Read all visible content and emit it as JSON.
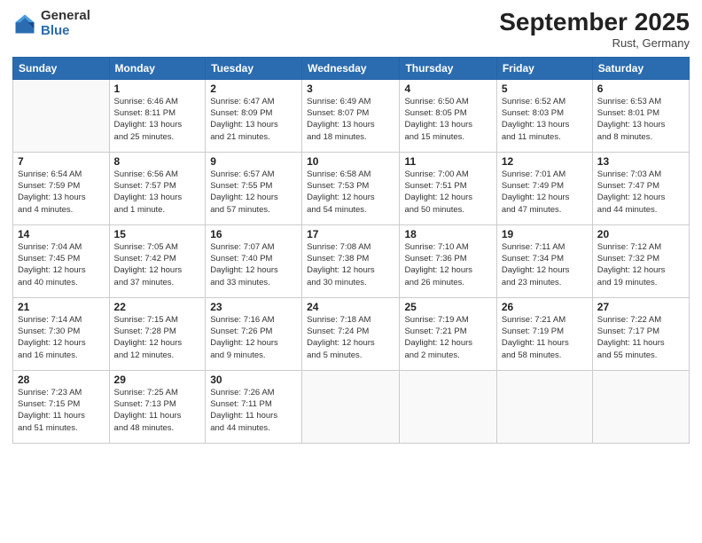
{
  "logo": {
    "general": "General",
    "blue": "Blue"
  },
  "title": "September 2025",
  "location": "Rust, Germany",
  "days_header": [
    "Sunday",
    "Monday",
    "Tuesday",
    "Wednesday",
    "Thursday",
    "Friday",
    "Saturday"
  ],
  "weeks": [
    [
      {
        "num": "",
        "info": ""
      },
      {
        "num": "1",
        "info": "Sunrise: 6:46 AM\nSunset: 8:11 PM\nDaylight: 13 hours\nand 25 minutes."
      },
      {
        "num": "2",
        "info": "Sunrise: 6:47 AM\nSunset: 8:09 PM\nDaylight: 13 hours\nand 21 minutes."
      },
      {
        "num": "3",
        "info": "Sunrise: 6:49 AM\nSunset: 8:07 PM\nDaylight: 13 hours\nand 18 minutes."
      },
      {
        "num": "4",
        "info": "Sunrise: 6:50 AM\nSunset: 8:05 PM\nDaylight: 13 hours\nand 15 minutes."
      },
      {
        "num": "5",
        "info": "Sunrise: 6:52 AM\nSunset: 8:03 PM\nDaylight: 13 hours\nand 11 minutes."
      },
      {
        "num": "6",
        "info": "Sunrise: 6:53 AM\nSunset: 8:01 PM\nDaylight: 13 hours\nand 8 minutes."
      }
    ],
    [
      {
        "num": "7",
        "info": "Sunrise: 6:54 AM\nSunset: 7:59 PM\nDaylight: 13 hours\nand 4 minutes."
      },
      {
        "num": "8",
        "info": "Sunrise: 6:56 AM\nSunset: 7:57 PM\nDaylight: 13 hours\nand 1 minute."
      },
      {
        "num": "9",
        "info": "Sunrise: 6:57 AM\nSunset: 7:55 PM\nDaylight: 12 hours\nand 57 minutes."
      },
      {
        "num": "10",
        "info": "Sunrise: 6:58 AM\nSunset: 7:53 PM\nDaylight: 12 hours\nand 54 minutes."
      },
      {
        "num": "11",
        "info": "Sunrise: 7:00 AM\nSunset: 7:51 PM\nDaylight: 12 hours\nand 50 minutes."
      },
      {
        "num": "12",
        "info": "Sunrise: 7:01 AM\nSunset: 7:49 PM\nDaylight: 12 hours\nand 47 minutes."
      },
      {
        "num": "13",
        "info": "Sunrise: 7:03 AM\nSunset: 7:47 PM\nDaylight: 12 hours\nand 44 minutes."
      }
    ],
    [
      {
        "num": "14",
        "info": "Sunrise: 7:04 AM\nSunset: 7:45 PM\nDaylight: 12 hours\nand 40 minutes."
      },
      {
        "num": "15",
        "info": "Sunrise: 7:05 AM\nSunset: 7:42 PM\nDaylight: 12 hours\nand 37 minutes."
      },
      {
        "num": "16",
        "info": "Sunrise: 7:07 AM\nSunset: 7:40 PM\nDaylight: 12 hours\nand 33 minutes."
      },
      {
        "num": "17",
        "info": "Sunrise: 7:08 AM\nSunset: 7:38 PM\nDaylight: 12 hours\nand 30 minutes."
      },
      {
        "num": "18",
        "info": "Sunrise: 7:10 AM\nSunset: 7:36 PM\nDaylight: 12 hours\nand 26 minutes."
      },
      {
        "num": "19",
        "info": "Sunrise: 7:11 AM\nSunset: 7:34 PM\nDaylight: 12 hours\nand 23 minutes."
      },
      {
        "num": "20",
        "info": "Sunrise: 7:12 AM\nSunset: 7:32 PM\nDaylight: 12 hours\nand 19 minutes."
      }
    ],
    [
      {
        "num": "21",
        "info": "Sunrise: 7:14 AM\nSunset: 7:30 PM\nDaylight: 12 hours\nand 16 minutes."
      },
      {
        "num": "22",
        "info": "Sunrise: 7:15 AM\nSunset: 7:28 PM\nDaylight: 12 hours\nand 12 minutes."
      },
      {
        "num": "23",
        "info": "Sunrise: 7:16 AM\nSunset: 7:26 PM\nDaylight: 12 hours\nand 9 minutes."
      },
      {
        "num": "24",
        "info": "Sunrise: 7:18 AM\nSunset: 7:24 PM\nDaylight: 12 hours\nand 5 minutes."
      },
      {
        "num": "25",
        "info": "Sunrise: 7:19 AM\nSunset: 7:21 PM\nDaylight: 12 hours\nand 2 minutes."
      },
      {
        "num": "26",
        "info": "Sunrise: 7:21 AM\nSunset: 7:19 PM\nDaylight: 11 hours\nand 58 minutes."
      },
      {
        "num": "27",
        "info": "Sunrise: 7:22 AM\nSunset: 7:17 PM\nDaylight: 11 hours\nand 55 minutes."
      }
    ],
    [
      {
        "num": "28",
        "info": "Sunrise: 7:23 AM\nSunset: 7:15 PM\nDaylight: 11 hours\nand 51 minutes."
      },
      {
        "num": "29",
        "info": "Sunrise: 7:25 AM\nSunset: 7:13 PM\nDaylight: 11 hours\nand 48 minutes."
      },
      {
        "num": "30",
        "info": "Sunrise: 7:26 AM\nSunset: 7:11 PM\nDaylight: 11 hours\nand 44 minutes."
      },
      {
        "num": "",
        "info": ""
      },
      {
        "num": "",
        "info": ""
      },
      {
        "num": "",
        "info": ""
      },
      {
        "num": "",
        "info": ""
      }
    ]
  ]
}
